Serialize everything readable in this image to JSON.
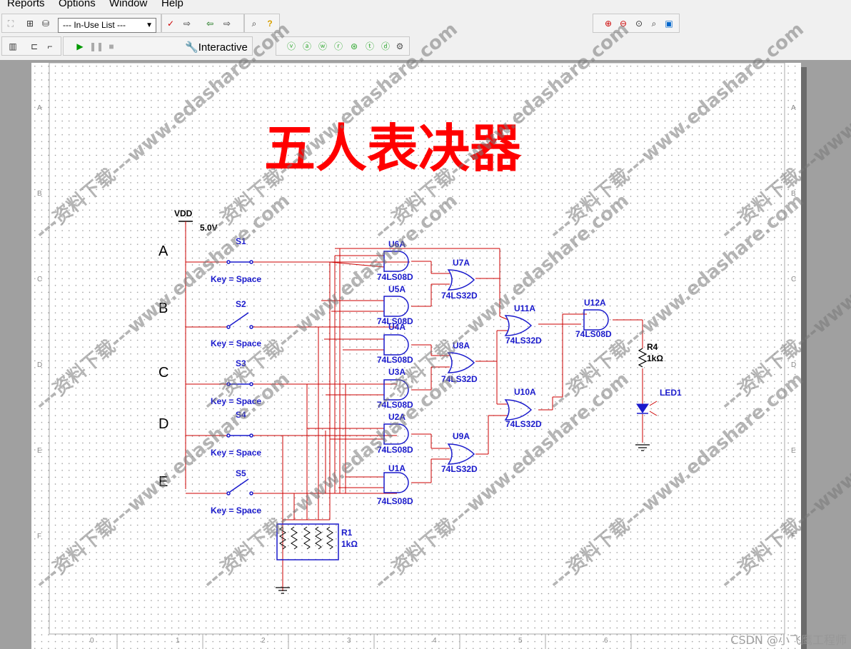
{
  "menu": {
    "reports": "Reports",
    "options": "Options",
    "window": "Window",
    "help": "Help"
  },
  "toolbar": {
    "inuse": "--- In-Use List ---",
    "interactive": "Interactive"
  },
  "title": "五人表决器",
  "inputs": [
    "A",
    "B",
    "C",
    "D",
    "E"
  ],
  "switches": [
    {
      "ref": "S1",
      "key": "Key = Space"
    },
    {
      "ref": "S2",
      "key": "Key = Space"
    },
    {
      "ref": "S3",
      "key": "Key = Space"
    },
    {
      "ref": "S4",
      "key": "Key = Space"
    },
    {
      "ref": "S5",
      "key": "Key = Space"
    }
  ],
  "supply": {
    "name": "VDD",
    "value": "5.0V"
  },
  "and_gates": [
    {
      "ref": "U6A",
      "part": "74LS08D"
    },
    {
      "ref": "U5A",
      "part": "74LS08D"
    },
    {
      "ref": "U4A",
      "part": "74LS08D"
    },
    {
      "ref": "U3A",
      "part": "74LS08D"
    },
    {
      "ref": "U2A",
      "part": "74LS08D"
    },
    {
      "ref": "U1A",
      "part": "74LS08D"
    },
    {
      "ref": "U12A",
      "part": "74LS08D"
    }
  ],
  "or_gates": [
    {
      "ref": "U7A",
      "part": "74LS32D"
    },
    {
      "ref": "U8A",
      "part": "74LS32D"
    },
    {
      "ref": "U9A",
      "part": "74LS32D"
    },
    {
      "ref": "U11A",
      "part": "74LS32D"
    },
    {
      "ref": "U10A",
      "part": "74LS32D"
    }
  ],
  "r4": {
    "ref": "R4",
    "value": "1kΩ"
  },
  "r1": {
    "ref": "R1",
    "value": "1kΩ"
  },
  "led": {
    "ref": "LED1"
  },
  "watermark": "---资料下载---www.edashare.com",
  "border_cols": [
    "0",
    "1",
    "2",
    "3",
    "4",
    "5",
    "6"
  ],
  "border_rows": [
    "A",
    "B",
    "C",
    "D",
    "E",
    "F"
  ],
  "csdn": "CSDN @小飞鹰工程师",
  "colors": {
    "wire": "#cc0000",
    "component": "#1a1acc",
    "title": "#ff0000"
  }
}
